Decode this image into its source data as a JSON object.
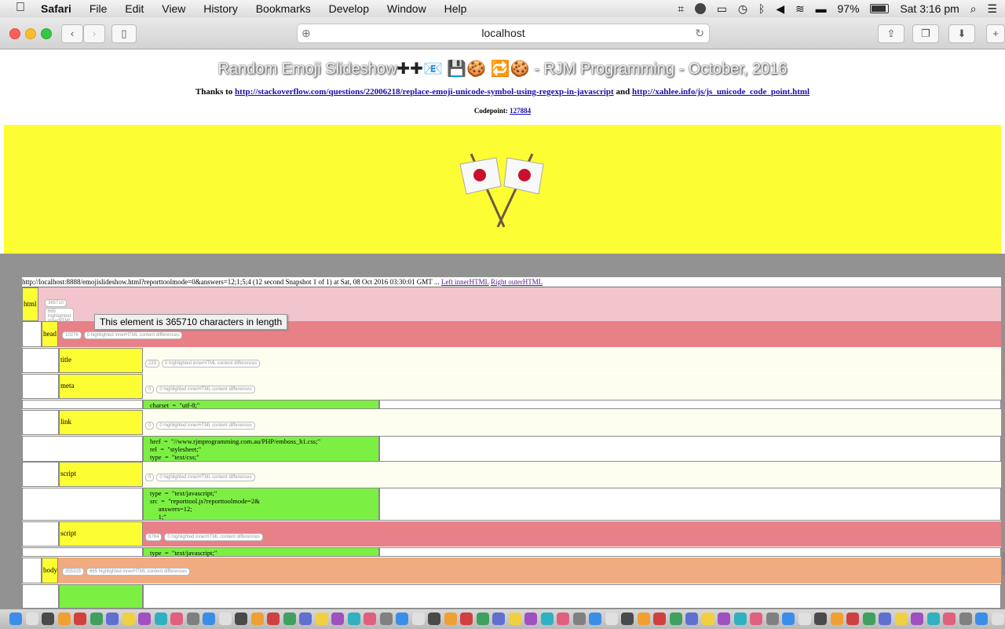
{
  "menubar": {
    "apple": "",
    "app_name": "Safari",
    "menus": [
      "File",
      "Edit",
      "View",
      "History",
      "Bookmarks",
      "Develop",
      "Window",
      "Help"
    ],
    "battery": "97%",
    "clock": "Sat 3:16 pm"
  },
  "browser": {
    "url": "localhost"
  },
  "page": {
    "title_text": "Random Emoji Slideshow",
    "title_emojis": "✚✚📧 💾🍪 🔁🍪",
    "title_suffix": " - RJM Programming - October, 2016",
    "thanks_prefix": "Thanks to ",
    "thanks_link1": "http://stackoverflow.com/questions/22006218/replace-emoji-unicode-symbol-using-regexp-in-javascript",
    "thanks_and": " and ",
    "thanks_link2": "http://xahlee.info/js/js_unicode_code_point.html",
    "codepoint_label": "Codepoint: ",
    "codepoint_value": "127884",
    "banner_emoji": "🎌"
  },
  "report": {
    "header_text": "http://localhost:8888/emojislideshow.html?reporttoolmode=0&answers=12;1;5;4 (12 second Snapshot 1 of 1) at Sat, 08 Oct 2016 03:30:01 GMT ... ",
    "header_link1": "Left innerHTML",
    "header_link2": "Right outerHTML",
    "rows": {
      "html": {
        "tag": "html",
        "length": "365710",
        "diff": "665 highlighted innerHTML content differences"
      },
      "head": {
        "tag": "head",
        "length": "10276",
        "diff": "0 highlighted innerHTML content differences"
      },
      "title": {
        "tag": "title",
        "length": "223",
        "diff": "0 highlighted innerHTML content differences"
      },
      "meta": {
        "tag": "meta",
        "length": "0",
        "diff": "0 highlighted innerHTML content differences"
      },
      "meta_attrs": "charset  =  \"utf-8;\"",
      "link": {
        "tag": "link",
        "length": "0",
        "diff": "0 highlighted innerHTML content differences"
      },
      "link_attrs": "href  =  \"//www.rjmprogramming.com.au/PHP/emboss_h1.css;\"\nrel  =  \"stylesheet;\"\ntype  =  \"text/css;\"",
      "script1": {
        "tag": "script",
        "length": "0",
        "diff": "0 highlighted innerHTML content differences"
      },
      "script1_attrs": "type  =  \"text/javascript;\"\nsrc  =  \"reporttool.js?reporttoolmode=2&\n     answers=12;\n     1;\"",
      "script2": {
        "tag": "script",
        "length": "9784",
        "diff": "0 highlighted innerHTML content differences"
      },
      "script2_attrs": "type  =  \"text/javascript;\"",
      "body": {
        "tag": "body",
        "length": "355329",
        "diff": "665 highlighted innerHTML content differences"
      }
    },
    "tooltip": "This element is 365710 characters in length"
  },
  "colors": {
    "yellow": "#fdfd33",
    "pink_light": "#f2c4cc",
    "pink": "#e88088",
    "cream": "#fefef0",
    "green": "#7cf042",
    "orange": "#f0ab80",
    "grey": "#929292"
  }
}
